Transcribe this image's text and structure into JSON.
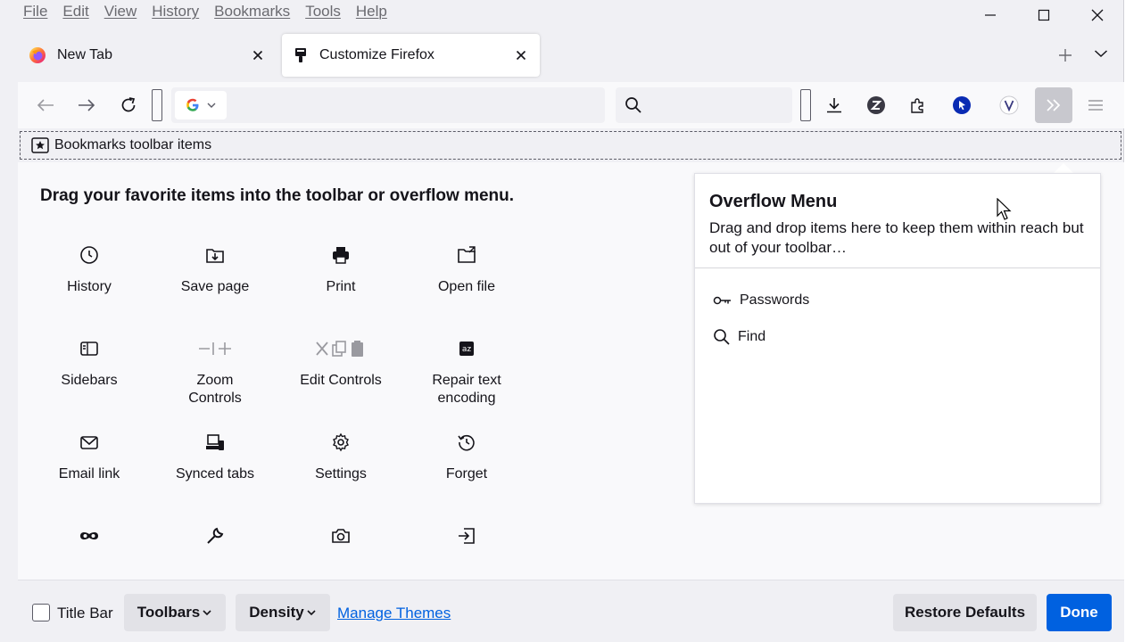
{
  "menubar": {
    "items": [
      "File",
      "Edit",
      "View",
      "History",
      "Bookmarks",
      "Tools",
      "Help"
    ]
  },
  "tabs": [
    {
      "title": "New Tab",
      "icon": "firefox-logo-icon",
      "selected": false
    },
    {
      "title": "Customize Firefox",
      "icon": "paintbrush-icon",
      "selected": true
    }
  ],
  "navbar": {
    "urlbar_value": "",
    "search_engine": "Google"
  },
  "bookmarks_toolbar": {
    "label": "Bookmarks toolbar items"
  },
  "palette": {
    "heading": "Drag your favorite items into the toolbar or overflow menu.",
    "items": [
      {
        "label": "History",
        "icon": "clock-icon"
      },
      {
        "label": "Save page",
        "icon": "save-page-icon"
      },
      {
        "label": "Print",
        "icon": "printer-icon"
      },
      {
        "label": "Open file",
        "icon": "open-folder-icon"
      },
      {
        "label": "Sidebars",
        "icon": "sidebar-icon"
      },
      {
        "label": "Zoom Controls",
        "icon": "zoom-controls-icon"
      },
      {
        "label": "Edit Controls",
        "icon": "edit-controls-icon"
      },
      {
        "label": "Repair text encoding",
        "icon": "text-encoding-icon"
      },
      {
        "label": "Email link",
        "icon": "email-icon"
      },
      {
        "label": "Synced tabs",
        "icon": "synced-tabs-icon"
      },
      {
        "label": "Settings",
        "icon": "gear-icon"
      },
      {
        "label": "Forget",
        "icon": "forget-icon"
      },
      {
        "label": "",
        "icon": "private-mask-icon"
      },
      {
        "label": "",
        "icon": "wrench-icon"
      },
      {
        "label": "",
        "icon": "camera-icon"
      },
      {
        "label": "",
        "icon": "sign-in-icon"
      }
    ]
  },
  "overflow_panel": {
    "title": "Overflow Menu",
    "description": "Drag and drop items here to keep them within reach but out of your toolbar…",
    "items": [
      {
        "label": "Passwords",
        "icon": "key-icon"
      },
      {
        "label": "Find",
        "icon": "search-icon"
      }
    ]
  },
  "bottombar": {
    "titlebar_label": "Title Bar",
    "titlebar_checked": false,
    "toolbars_label": "Toolbars",
    "density_label": "Density",
    "manage_themes_label": "Manage Themes",
    "restore_defaults_label": "Restore Defaults",
    "done_label": "Done"
  },
  "colors": {
    "accent": "#0061e0",
    "chrome": "#f0f0f4",
    "content": "#f9f9fb",
    "text": "#15141a"
  }
}
